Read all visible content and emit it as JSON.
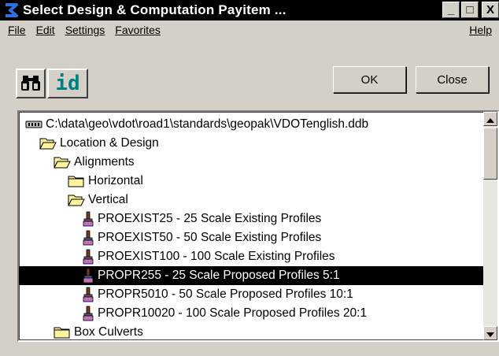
{
  "window": {
    "title": "Select Design & Computation Payitem ...",
    "minimize_glyph": "_",
    "maximize_glyph": "□",
    "close_glyph": "X"
  },
  "menu": {
    "file": "File",
    "edit": "Edit",
    "settings": "Settings",
    "favorites": "Favorites",
    "help": "Help"
  },
  "toolbar": {
    "find_icon": "binoculars-icon",
    "id_label": "id",
    "ok_label": "OK",
    "close_label": "Close"
  },
  "tree": {
    "items": [
      {
        "label": "C:\\data\\geo\\vdot\\road1\\standards\\geopak\\VDOTenglish.ddb",
        "icon": "database-icon",
        "depth": 0,
        "selected": false
      },
      {
        "label": "Location & Design",
        "icon": "folder-open-icon",
        "depth": 1,
        "selected": false
      },
      {
        "label": "Alignments",
        "icon": "folder-open-icon",
        "depth": 2,
        "selected": false
      },
      {
        "label": "Horizontal",
        "icon": "folder-closed-icon",
        "depth": 3,
        "selected": false
      },
      {
        "label": "Vertical",
        "icon": "folder-open-icon",
        "depth": 3,
        "selected": false
      },
      {
        "label": "PROEXIST25 - 25 Scale Existing Profiles",
        "icon": "paintbrush-icon",
        "depth": 4,
        "selected": false
      },
      {
        "label": "PROEXIST50 - 50 Scale Existing Profiles",
        "icon": "paintbrush-icon",
        "depth": 4,
        "selected": false
      },
      {
        "label": "PROEXIST100 - 100 Scale Existing Profiles",
        "icon": "paintbrush-icon",
        "depth": 4,
        "selected": false
      },
      {
        "label": "PROPR255 - 25 Scale Proposed Profiles 5:1",
        "icon": "paintbrush-icon",
        "depth": 4,
        "selected": true
      },
      {
        "label": "PROPR5010 - 50 Scale Proposed Profiles 10:1",
        "icon": "paintbrush-icon",
        "depth": 4,
        "selected": false
      },
      {
        "label": "PROPR10020 - 100 Scale Proposed Profiles 20:1",
        "icon": "paintbrush-icon",
        "depth": 4,
        "selected": false
      },
      {
        "label": "Box Culverts",
        "icon": "folder-closed-icon",
        "depth": 2,
        "selected": false
      }
    ]
  },
  "colors": {
    "titlebar_bg": "#000000",
    "selection_bg": "#000000",
    "folder_fill": "#fff3a0",
    "brush_handle": "#7a3b1a",
    "brush_bristles": "#c070c0",
    "id_text": "#008080"
  }
}
